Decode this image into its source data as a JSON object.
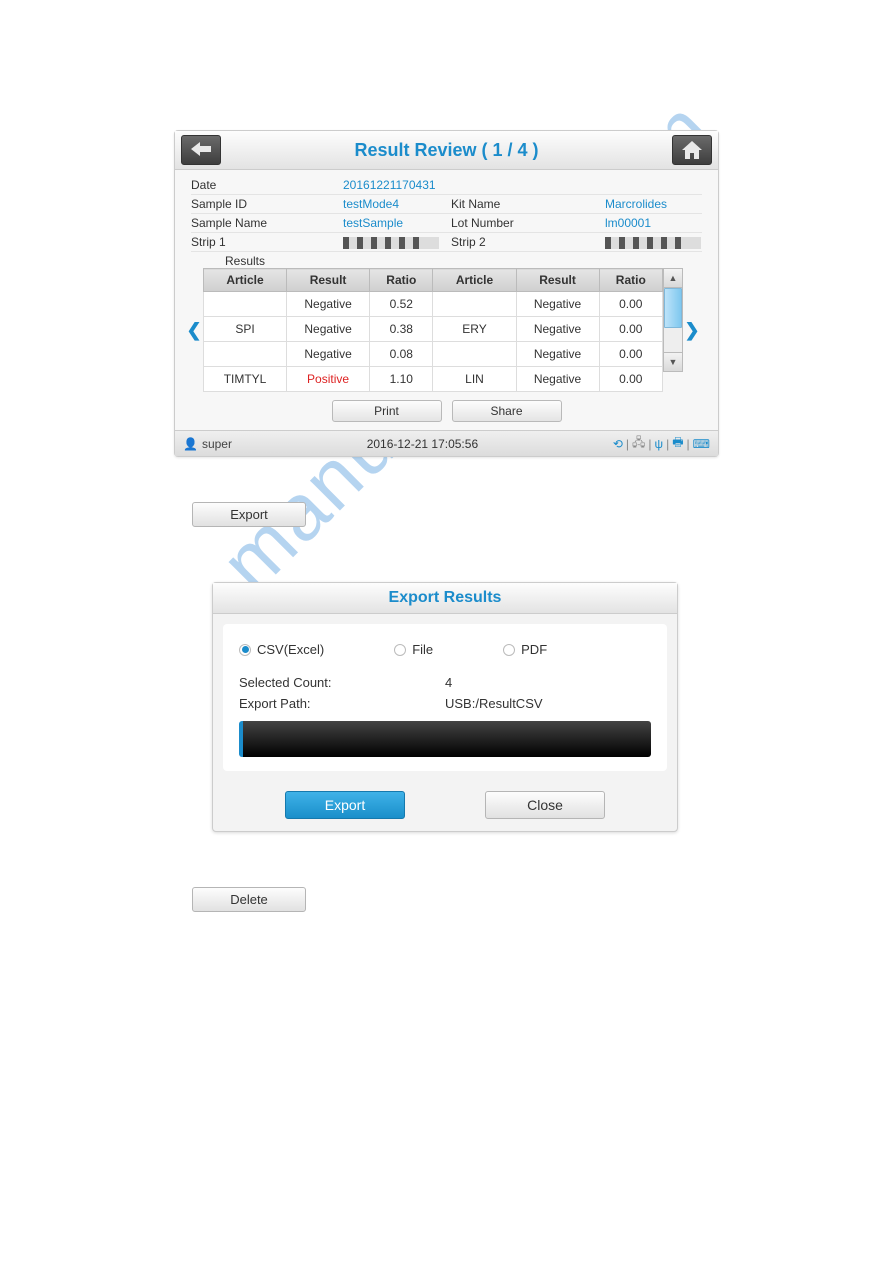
{
  "watermark": "manualshive.com",
  "panel1": {
    "title": "Result Review ( 1 / 4 )",
    "meta": {
      "date_label": "Date",
      "date_value": "20161221170431",
      "sample_id_label": "Sample ID",
      "sample_id_value": "testMode4",
      "kit_name_label": "Kit Name",
      "kit_name_value": "Marcrolides",
      "sample_name_label": "Sample Name",
      "sample_name_value": "testSample",
      "lot_number_label": "Lot Number",
      "lot_number_value": "lm00001",
      "strip1_label": "Strip 1",
      "strip2_label": "Strip 2"
    },
    "results_label": "Results",
    "columns": {
      "article": "Article",
      "result": "Result",
      "ratio": "Ratio"
    },
    "rows": [
      {
        "a1": "",
        "r1": "Negative",
        "t1": "0.52",
        "a2": "",
        "r2": "Negative",
        "t2": "0.00"
      },
      {
        "a1": "SPI",
        "r1": "Negative",
        "t1": "0.38",
        "a2": "ERY",
        "r2": "Negative",
        "t2": "0.00"
      },
      {
        "a1": "",
        "r1": "Negative",
        "t1": "0.08",
        "a2": "",
        "r2": "Negative",
        "t2": "0.00"
      },
      {
        "a1": "TIMTYL",
        "r1": "Positive",
        "t1": "1.10",
        "a2": "LIN",
        "r2": "Negative",
        "t2": "0.00",
        "pos": true
      }
    ],
    "print_label": "Print",
    "share_label": "Share",
    "status_user": "super",
    "status_time": "2016-12-21 17:05:56"
  },
  "export_button_label": "Export",
  "panel2": {
    "title": "Export Results",
    "opt_csv": "CSV(Excel)",
    "opt_file": "File",
    "opt_pdf": "PDF",
    "selected_count_label": "Selected Count:",
    "selected_count_value": "4",
    "export_path_label": "Export Path:",
    "export_path_value": "USB:/ResultCSV",
    "export_label": "Export",
    "close_label": "Close"
  },
  "delete_button_label": "Delete"
}
